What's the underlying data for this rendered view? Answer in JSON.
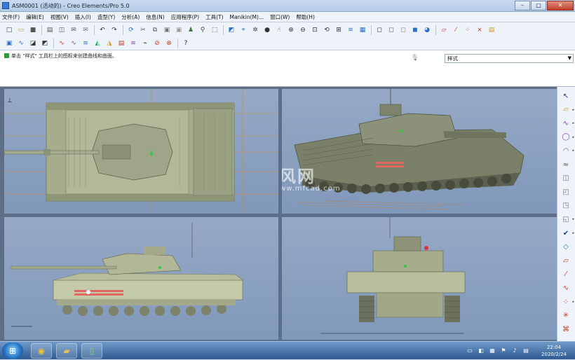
{
  "window": {
    "title": "ASM0001 (活动的) - Creo Elements/Pro 5.0",
    "controls": {
      "minimize": "–",
      "maximize": "□",
      "close": "✕"
    }
  },
  "menubar": {
    "items": [
      "文件(F)",
      "编辑(E)",
      "视图(V)",
      "插入(I)",
      "造型(Y)",
      "分析(A)",
      "信息(N)",
      "应用程序(P)",
      "工具(T)",
      "Manikin(M)...",
      "窗口(W)",
      "帮助(H)"
    ]
  },
  "toolbar": {
    "row1": [
      {
        "name": "new-file-icon",
        "glyph": "□",
        "color": "#444"
      },
      {
        "name": "open-file-icon",
        "glyph": "▭",
        "color": "#c79a2a"
      },
      {
        "name": "save-icon",
        "glyph": "■",
        "color": "#555"
      },
      {
        "sep": true
      },
      {
        "name": "print-icon",
        "glyph": "▤",
        "color": "#555"
      },
      {
        "name": "print-preview-icon",
        "glyph": "◫",
        "color": "#555"
      },
      {
        "name": "email-icon",
        "glyph": "✉",
        "color": "#555"
      },
      {
        "name": "email-attach-icon",
        "glyph": "✉",
        "color": "#777"
      },
      {
        "sep": true
      },
      {
        "name": "undo-icon",
        "glyph": "↶",
        "color": "#333"
      },
      {
        "name": "redo-icon",
        "glyph": "↷",
        "color": "#333"
      },
      {
        "sep": true
      },
      {
        "name": "regenerate-icon",
        "glyph": "⟳",
        "color": "#2a6fc9"
      },
      {
        "name": "cut-icon",
        "glyph": "✂",
        "color": "#555"
      },
      {
        "name": "copy-icon",
        "glyph": "⧉",
        "color": "#555"
      },
      {
        "name": "paste-icon",
        "glyph": "▣",
        "color": "#777"
      },
      {
        "name": "paste-special-icon",
        "glyph": "▣",
        "color": "#999"
      },
      {
        "name": "model-player-icon",
        "glyph": "♟",
        "color": "#3a7a3a"
      },
      {
        "name": "find-icon",
        "glyph": "⚲",
        "color": "#444"
      },
      {
        "name": "select-box-icon",
        "glyph": "⬚",
        "color": "#444"
      },
      {
        "sep": true
      },
      {
        "name": "repaint-icon",
        "glyph": "◩",
        "color": "#2a6fc9"
      },
      {
        "name": "spin-center-icon",
        "glyph": "⌖",
        "color": "#2a6fc9"
      },
      {
        "name": "orient-mode-icon",
        "glyph": "✲",
        "color": "#444"
      },
      {
        "name": "appearance-icon",
        "glyph": "●",
        "color": "#333"
      },
      {
        "name": "pan-icon",
        "glyph": "☝",
        "color": "#555"
      },
      {
        "name": "zoom-in-icon",
        "glyph": "⊕",
        "color": "#333"
      },
      {
        "name": "zoom-out-icon",
        "glyph": "⊖",
        "color": "#333"
      },
      {
        "name": "zoom-fit-icon",
        "glyph": "⊡",
        "color": "#333"
      },
      {
        "name": "reorient-icon",
        "glyph": "⟲",
        "color": "#333"
      },
      {
        "name": "saved-views-icon",
        "glyph": "⊞",
        "color": "#333"
      },
      {
        "name": "layers-icon",
        "glyph": "≋",
        "color": "#2a6fc9"
      },
      {
        "name": "view-manager-icon",
        "glyph": "▦",
        "color": "#2a6fc9"
      },
      {
        "sep": true
      },
      {
        "name": "wireframe-icon",
        "glyph": "◻",
        "color": "#333"
      },
      {
        "name": "hidden-line-icon",
        "glyph": "◻",
        "color": "#555"
      },
      {
        "name": "no-hidden-icon",
        "glyph": "◻",
        "color": "#777"
      },
      {
        "name": "shading-icon",
        "glyph": "◼",
        "color": "#2a6fc9"
      },
      {
        "name": "enhanced-realism-icon",
        "glyph": "◕",
        "color": "#2a6fc9"
      },
      {
        "sep": true
      },
      {
        "name": "datum-planes-icon",
        "glyph": "▱",
        "color": "#c0392b"
      },
      {
        "name": "datum-axes-icon",
        "glyph": "⁄",
        "color": "#c0392b"
      },
      {
        "name": "datum-points-icon",
        "glyph": "⁘",
        "color": "#c0392b"
      },
      {
        "name": "coord-sys-icon",
        "glyph": "⨯",
        "color": "#c0392b"
      },
      {
        "name": "annotations-icon",
        "glyph": "▤",
        "color": "#c79a2a"
      }
    ],
    "row2": [
      {
        "name": "style-save-icon",
        "glyph": "▣",
        "color": "#2a6fc9"
      },
      {
        "name": "style-curve-icon",
        "glyph": "∿",
        "color": "#2a6fc9"
      },
      {
        "name": "style-surface-icon",
        "glyph": "◪",
        "color": "#333"
      },
      {
        "name": "style-trim-icon",
        "glyph": "◩",
        "color": "#333"
      },
      {
        "sep": true
      },
      {
        "name": "curve-analysis-icon",
        "glyph": "∿",
        "color": "#c0392b"
      },
      {
        "name": "curvature-icon",
        "glyph": "∿",
        "color": "#8e44ad"
      },
      {
        "name": "section-icon",
        "glyph": "≡",
        "color": "#2a6fc9"
      },
      {
        "name": "reflection-icon",
        "glyph": "◭",
        "color": "#27ae60"
      },
      {
        "name": "slope-icon",
        "glyph": "◮",
        "color": "#c79a2a"
      },
      {
        "name": "draft-check-icon",
        "glyph": "▤",
        "color": "#c0392b"
      },
      {
        "name": "gaussian-icon",
        "glyph": "≋",
        "color": "#8e44ad"
      },
      {
        "name": "connection-icon",
        "glyph": "⌁",
        "color": "#333"
      },
      {
        "name": "offset-analysis-icon",
        "glyph": "⊘",
        "color": "#c0392b"
      },
      {
        "name": "deviation-icon",
        "glyph": "⊗",
        "color": "#c0392b"
      },
      {
        "sep": true
      },
      {
        "name": "context-help-icon",
        "glyph": "?",
        "color": "#222"
      }
    ]
  },
  "message": {
    "text": "单击 \"样式\" 工具栏上的图标来创建曲线和曲面。",
    "style_select": "样式"
  },
  "watermark": {
    "cn": "沐风网",
    "url": "www.mfcad.com"
  },
  "right_toolbar": [
    {
      "name": "select-arrow-icon",
      "glyph": "↖",
      "color": "#1a3f7a",
      "arrow": false
    },
    {
      "name": "set-active-plane-icon",
      "glyph": "▱",
      "color": "#c79a2a",
      "arrow": true
    },
    {
      "name": "create-curve-icon",
      "glyph": "∿",
      "color": "#8e44ad",
      "arrow": true
    },
    {
      "name": "circle-icon",
      "glyph": "◯",
      "color": "#8e44ad",
      "arrow": true
    },
    {
      "name": "arc-icon",
      "glyph": "◠",
      "color": "#8e44ad",
      "arrow": true
    },
    {
      "name": "edit-curve-icon",
      "glyph": "≈",
      "color": "#555",
      "arrow": false
    },
    {
      "name": "curve-on-surface-icon",
      "glyph": "◫",
      "color": "#777",
      "arrow": false
    },
    {
      "name": "offset-curve-icon",
      "glyph": "◰",
      "color": "#777",
      "arrow": false
    },
    {
      "name": "project-curve-icon",
      "glyph": "◳",
      "color": "#777",
      "arrow": false
    },
    {
      "name": "trim-icon",
      "glyph": "◱",
      "color": "#777",
      "arrow": true
    },
    {
      "name": "done-check-icon",
      "glyph": "✔",
      "color": "#1a3f7a",
      "arrow": true
    },
    {
      "name": "surface-icon",
      "glyph": "◇",
      "color": "#2a6fc9",
      "arrow": false
    },
    {
      "name": "boundary-surface-icon",
      "glyph": "▱",
      "color": "#c0392b",
      "arrow": false
    },
    {
      "name": "datum-axis-icon",
      "glyph": "⁄",
      "color": "#c0392b",
      "arrow": false
    },
    {
      "name": "sketch-curve-icon",
      "glyph": "∿",
      "color": "#c0392b",
      "arrow": false
    },
    {
      "name": "point-icon",
      "glyph": "⁘",
      "color": "#c0392b",
      "arrow": true
    },
    {
      "name": "coordinate-icon",
      "glyph": "✳",
      "color": "#c0392b",
      "arrow": false
    },
    {
      "name": "surface-connect-icon",
      "glyph": "⌘",
      "color": "#c0392b",
      "arrow": false
    }
  ],
  "taskbar": {
    "apps": [
      {
        "name": "chrome-taskbar-icon",
        "glyph": "◉",
        "color": "#e8c23a"
      },
      {
        "name": "explorer-taskbar-icon",
        "glyph": "▰",
        "color": "#e6c15a"
      },
      {
        "name": "creo-taskbar-icon",
        "glyph": "▯",
        "color": "#7fd36a"
      }
    ],
    "time": "22:04",
    "date": "2020/2/24"
  }
}
